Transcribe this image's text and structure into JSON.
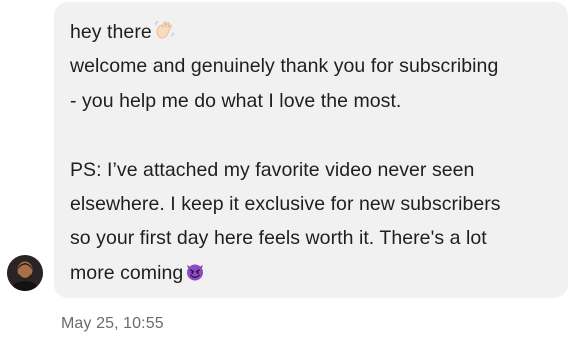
{
  "message": {
    "lines": [
      "hey there",
      "welcome and genuinely thank you for subscribing",
      "- you help me do what I love the most.",
      "",
      "PS: I’ve attached my favorite video never seen",
      "elsewhere. I keep it exclusive for new subscribers",
      "so your first day here feels worth it. There's a lot",
      "more coming"
    ],
    "emoji_wave": "waving-hand-emoji",
    "emoji_devil": "smiling-imp-emoji"
  },
  "timestamp": "May 25, 10:55",
  "colors": {
    "bubble_background": "#f1f1f2",
    "text": "#1f1f1f",
    "timestamp": "#6b6b70",
    "devil_purple": "#7d3fb3"
  }
}
